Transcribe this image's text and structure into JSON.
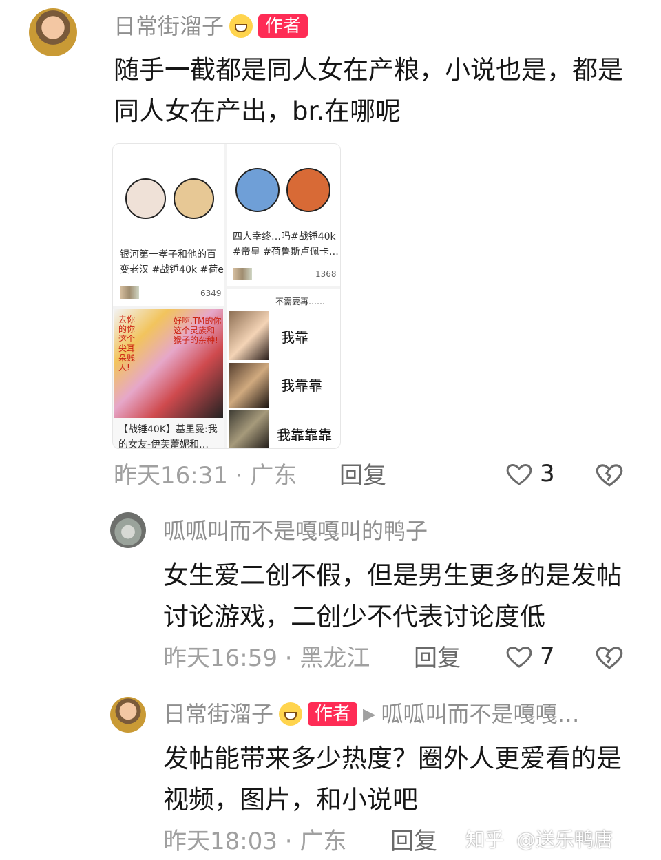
{
  "comments": [
    {
      "author": "日常街溜子",
      "badge": "作者",
      "text": "随手一截都是同人女在产粮，小说也是，都是同人女在产出，br.在哪呢",
      "time": "昨天16:31",
      "location": "广东",
      "reply": "回复",
      "likes": "3"
    },
    {
      "author": "呱呱叫而不是嘎嘎叫的鸭子",
      "text": "女生爱二创不假，但是男生更多的是发帖讨论游戏，二创少不代表讨论度低",
      "time": "昨天16:59",
      "location": "黑龙江",
      "reply": "回复",
      "likes": "7"
    },
    {
      "author": "日常街溜子",
      "badge": "作者",
      "reply_to": "呱呱叫而不是嘎嘎…",
      "text": "发帖能带来多少热度？圈外人更爱看的是视频，图片，和小说吧",
      "time": "昨天18:03",
      "location": "广东",
      "reply": "回复"
    }
  ],
  "collage": {
    "post1": {
      "names": [
        "银河第一孝子和他的百",
        "变老汉 #战锤40k #荷e"
      ],
      "likes": "6349"
    },
    "post2": {
      "names": [
        "四人幸终…吗#战锤40k",
        "#帝皇 #荷鲁斯卢佩卡…"
      ],
      "likes": "1368"
    },
    "post3": {
      "bubble_left": "去你的你这个尖耳朵贱人!",
      "bubble_right": "好啊,TM的你这个灵族和猴子的杂种!",
      "caption": [
        "【战锤40K】基里曼:我",
        "的女友-伊芙蕾妮和…"
      ]
    },
    "post4": {
      "lines": [
        "我靠",
        "我靠靠",
        "我靠靠靠"
      ],
      "top_note": "不需要再……"
    }
  },
  "watermark": {
    "left": "知乎",
    "right": "@送乐鸭唐"
  },
  "colors": {
    "badge": "#fe2c55",
    "meta": "#a0a0a0",
    "background": "#ffffff"
  }
}
